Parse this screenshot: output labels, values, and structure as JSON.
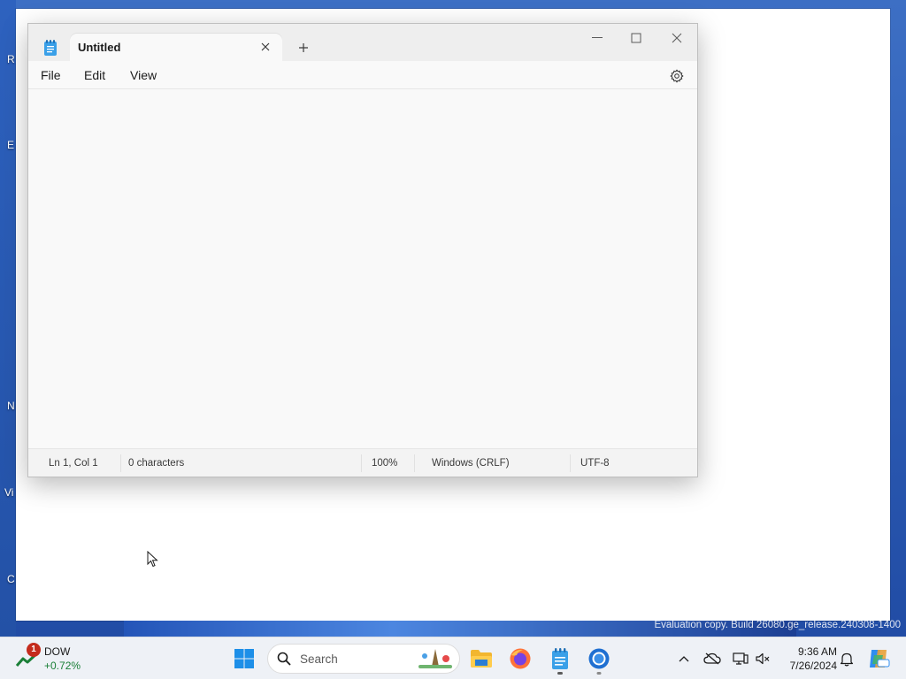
{
  "desktop": {
    "edge_letters": [
      "R",
      "E",
      "N",
      "Vi",
      "C"
    ],
    "watermark": "Evaluation copy. Build 26080.ge_release.240308-1400"
  },
  "notepad": {
    "tab_title": "Untitled",
    "menu": [
      "File",
      "Edit",
      "View"
    ],
    "editor_text": "",
    "status": {
      "position": "Ln 1, Col 1",
      "characters": "0 characters",
      "zoom": "100%",
      "line_ending": "Windows (CRLF)",
      "encoding": "UTF-8"
    }
  },
  "taskbar": {
    "widget": {
      "badge": "1",
      "title": "DOW",
      "value": "+0.72%"
    },
    "search_placeholder": "Search",
    "pinned": [
      "start-icon",
      "file-explorer-icon",
      "firefox-icon",
      "notepad-icon",
      "chrome-icon"
    ],
    "clock": {
      "time": "9:36 AM",
      "date": "7/26/2024"
    },
    "colors": {
      "accent": "#0067c0",
      "widget_positive": "#1a7f37",
      "badge": "#c42b1c"
    }
  }
}
